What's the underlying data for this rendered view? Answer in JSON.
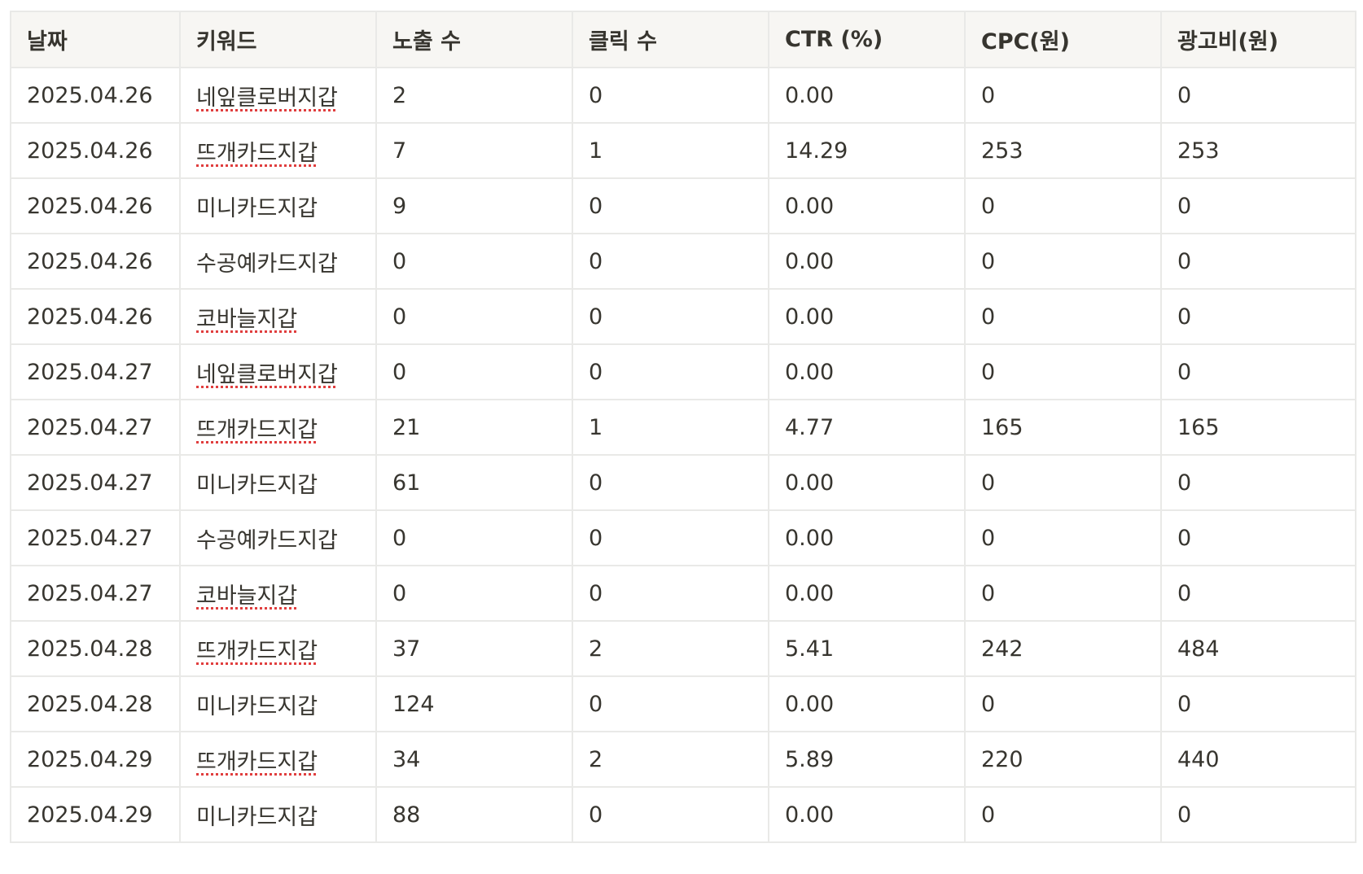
{
  "table": {
    "headers": [
      "날짜",
      "키워드",
      "노출 수",
      "클릭 수",
      "CTR (%)",
      "CPC(원)",
      "광고비(원)"
    ],
    "rows": [
      {
        "date": "2025.04.26",
        "keyword": "네잎클로버지갑",
        "impressions": "2",
        "clicks": "0",
        "ctr": "0.00",
        "cpc": "0",
        "cost": "0",
        "spell_flag": true
      },
      {
        "date": "2025.04.26",
        "keyword": "뜨개카드지갑",
        "impressions": "7",
        "clicks": "1",
        "ctr": "14.29",
        "cpc": "253",
        "cost": "253",
        "spell_flag": true
      },
      {
        "date": "2025.04.26",
        "keyword": "미니카드지갑",
        "impressions": "9",
        "clicks": "0",
        "ctr": "0.00",
        "cpc": "0",
        "cost": "0",
        "spell_flag": false
      },
      {
        "date": "2025.04.26",
        "keyword": "수공예카드지갑",
        "impressions": "0",
        "clicks": "0",
        "ctr": "0.00",
        "cpc": "0",
        "cost": "0",
        "spell_flag": false
      },
      {
        "date": "2025.04.26",
        "keyword": "코바늘지갑",
        "impressions": "0",
        "clicks": "0",
        "ctr": "0.00",
        "cpc": "0",
        "cost": "0",
        "spell_flag": true
      },
      {
        "date": "2025.04.27",
        "keyword": "네잎클로버지갑",
        "impressions": "0",
        "clicks": "0",
        "ctr": "0.00",
        "cpc": "0",
        "cost": "0",
        "spell_flag": true
      },
      {
        "date": "2025.04.27",
        "keyword": "뜨개카드지갑",
        "impressions": "21",
        "clicks": "1",
        "ctr": "4.77",
        "cpc": "165",
        "cost": "165",
        "spell_flag": true
      },
      {
        "date": "2025.04.27",
        "keyword": "미니카드지갑",
        "impressions": "61",
        "clicks": "0",
        "ctr": "0.00",
        "cpc": "0",
        "cost": "0",
        "spell_flag": false
      },
      {
        "date": "2025.04.27",
        "keyword": "수공예카드지갑",
        "impressions": "0",
        "clicks": "0",
        "ctr": "0.00",
        "cpc": "0",
        "cost": "0",
        "spell_flag": false
      },
      {
        "date": "2025.04.27",
        "keyword": "코바늘지갑",
        "impressions": "0",
        "clicks": "0",
        "ctr": "0.00",
        "cpc": "0",
        "cost": "0",
        "spell_flag": true
      },
      {
        "date": "2025.04.28",
        "keyword": "뜨개카드지갑",
        "impressions": "37",
        "clicks": "2",
        "ctr": "5.41",
        "cpc": "242",
        "cost": "484",
        "spell_flag": true
      },
      {
        "date": "2025.04.28",
        "keyword": "미니카드지갑",
        "impressions": "124",
        "clicks": "0",
        "ctr": "0.00",
        "cpc": "0",
        "cost": "0",
        "spell_flag": false
      },
      {
        "date": "2025.04.29",
        "keyword": "뜨개카드지갑",
        "impressions": "34",
        "clicks": "2",
        "ctr": "5.89",
        "cpc": "220",
        "cost": "440",
        "spell_flag": true
      },
      {
        "date": "2025.04.29",
        "keyword": "미니카드지갑",
        "impressions": "88",
        "clicks": "0",
        "ctr": "0.00",
        "cpc": "0",
        "cost": "0",
        "spell_flag": false
      }
    ]
  },
  "colors": {
    "header_bg": "#f7f6f3",
    "border": "#e9e9e7",
    "text": "#37352f",
    "spellcheck_underline": "#e03e3e"
  }
}
